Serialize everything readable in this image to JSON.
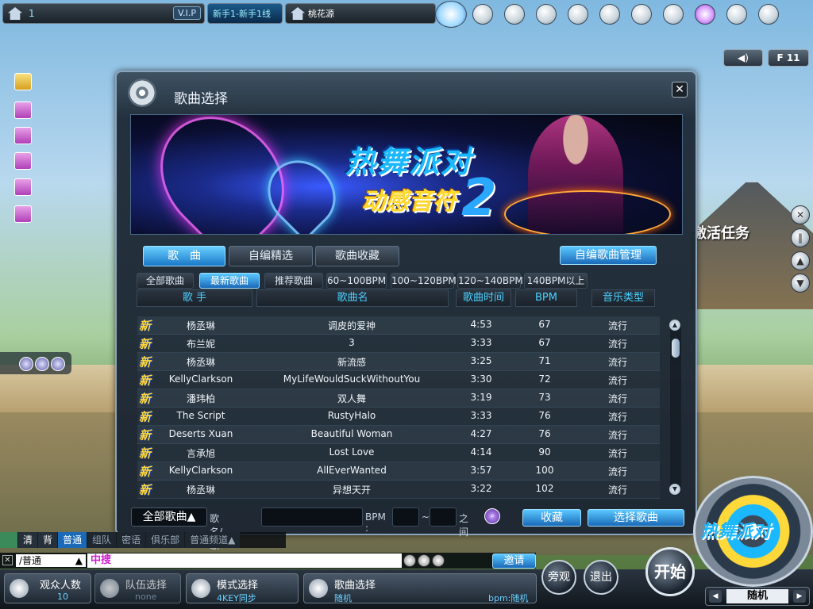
{
  "topbar": {
    "channel_number": "1",
    "vip_label": "V.I.P",
    "channel_name": "新手1-新手1线",
    "map_name": "桃花源",
    "icons": [
      "shop-cart-icon",
      "robot-face-icon",
      "box-icon",
      "link-icon",
      "chat-bubble-icon",
      "couple-icon",
      "podium-icon",
      "book-icon",
      "arrow-menu-icon",
      "gear-icon",
      "power-icon"
    ]
  },
  "side_controls": {
    "sound_label": "◀)",
    "f11_label": "F 11"
  },
  "background": {
    "activity_text": "激活任务"
  },
  "dialog": {
    "title": "歌曲选择",
    "close_label": "✕",
    "banner": {
      "logo_line1": "热舞派对",
      "logo_line2": "动感音符",
      "logo_number": "2"
    },
    "tabs": [
      {
        "label": "歌　曲",
        "active": true
      },
      {
        "label": "自编精选",
        "active": false
      },
      {
        "label": "歌曲收藏",
        "active": false
      }
    ],
    "manage_label": "自编歌曲管理",
    "subtabs": [
      {
        "label": "全部歌曲",
        "active": false
      },
      {
        "label": "最新歌曲",
        "active": true
      },
      {
        "label": "推荐歌曲",
        "active": false
      },
      {
        "label": "60~100BPM",
        "active": false
      },
      {
        "label": "100~120BPM",
        "active": false
      },
      {
        "label": "120~140BPM",
        "active": false
      },
      {
        "label": "140BPM以上",
        "active": false
      }
    ],
    "columns": {
      "artist": "歌 手",
      "song": "歌曲名",
      "time": "歌曲时间",
      "bpm": "BPM",
      "genre": "音乐类型"
    },
    "new_badge": "新",
    "songs": [
      {
        "artist": "杨丞琳",
        "song": "调皮的爱神",
        "time": "4:53",
        "bpm": "67",
        "genre": "流行"
      },
      {
        "artist": "布兰妮",
        "song": "3",
        "time": "3:33",
        "bpm": "67",
        "genre": "流行"
      },
      {
        "artist": "杨丞琳",
        "song": "新流感",
        "time": "3:25",
        "bpm": "71",
        "genre": "流行"
      },
      {
        "artist": "KellyClarkson",
        "song": "MyLifeWouldSuckWithoutYou",
        "time": "3:30",
        "bpm": "72",
        "genre": "流行"
      },
      {
        "artist": "潘玮柏",
        "song": "双人舞",
        "time": "3:19",
        "bpm": "73",
        "genre": "流行"
      },
      {
        "artist": "The Script",
        "song": "RustyHalo",
        "time": "3:33",
        "bpm": "76",
        "genre": "流行"
      },
      {
        "artist": "Deserts Xuan",
        "song": "Beautiful Woman",
        "time": "4:27",
        "bpm": "76",
        "genre": "流行"
      },
      {
        "artist": "言承旭",
        "song": "Lost Love",
        "time": "4:14",
        "bpm": "90",
        "genre": "流行"
      },
      {
        "artist": "KellyClarkson",
        "song": "AllEverWanted",
        "time": "3:57",
        "bpm": "100",
        "genre": "流行"
      },
      {
        "artist": "杨丞琳",
        "song": "异想天开",
        "time": "3:22",
        "bpm": "102",
        "genre": "流行"
      }
    ],
    "filter": {
      "category": "全部歌曲▲",
      "name_label": "歌名/歌手:",
      "bpm_label": "BPM :",
      "dash": "~",
      "between_label": "之间",
      "favorite_label": "收藏",
      "select_label": "选择歌曲"
    }
  },
  "chat": {
    "tabs": [
      {
        "label": "清",
        "style": "normal"
      },
      {
        "label": "背",
        "style": "normal"
      },
      {
        "label": "普通",
        "style": "hl"
      },
      {
        "label": "组队",
        "style": "dim"
      },
      {
        "label": "密语",
        "style": "dim"
      },
      {
        "label": "俱乐部",
        "style": "dim"
      },
      {
        "label": "普通频道▲",
        "style": "dim"
      }
    ],
    "close_label": "✕",
    "mode_value": "/普通",
    "mode_arrow": "▲",
    "input_value": "中搜",
    "invite_label": "邀请"
  },
  "bottom": {
    "audience_title": "观众人数",
    "audience_value": "10",
    "team_title": "队伍选择",
    "team_value": "none",
    "mode_title": "模式选择",
    "mode_value": "4KEY同步",
    "song_title": "歌曲选择",
    "song_value": "随机",
    "song_bpm": "bpm:随机",
    "watch_label": "旁观",
    "exit_label": "退出",
    "start_label": "开始",
    "disc_logo": "热舞派对",
    "random_value": "随机"
  }
}
